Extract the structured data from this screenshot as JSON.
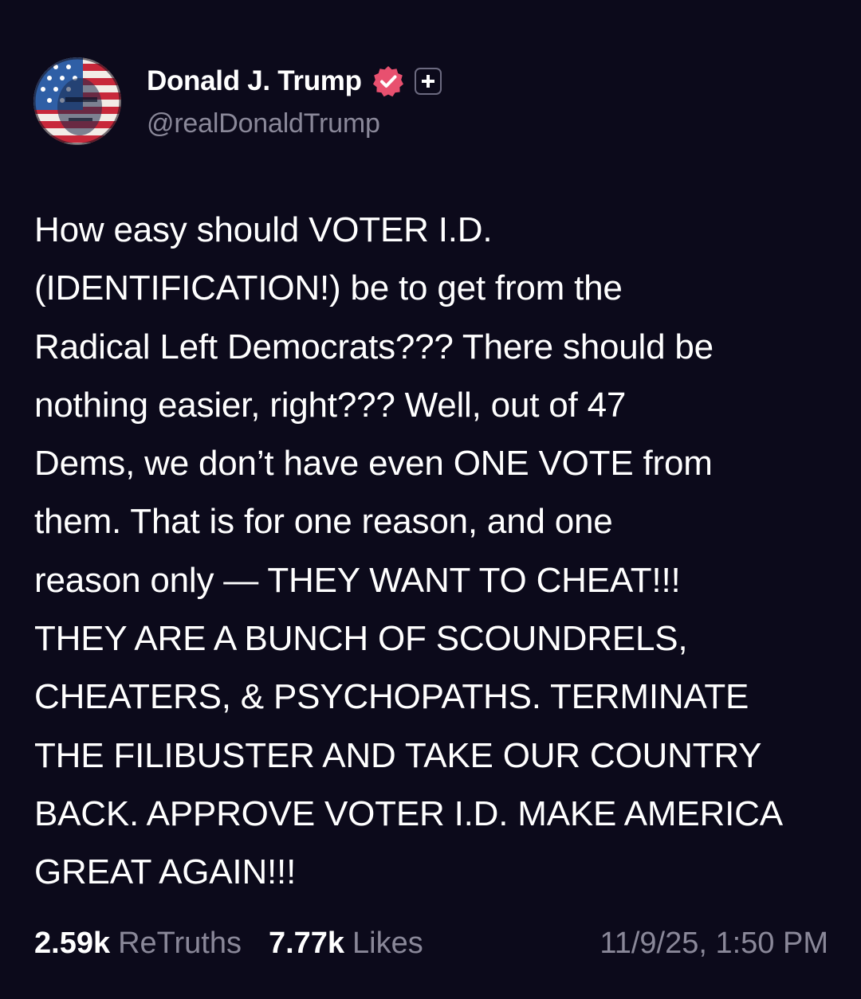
{
  "post": {
    "author": {
      "display_name": "Donald J. Trump",
      "handle": "@realDonaldTrump",
      "avatar_icon": "flag-face-portrait",
      "verified_icon": "verified-badge-icon",
      "verified_color": "#e8506f",
      "plus_icon": "plus-badge-icon"
    },
    "text": "How easy should VOTER I.D.\n(IDENTIFICATION!) be to get from the\nRadical Left Democrats??? There should be\nnothing easier, right??? Well, out of 47\nDems, we don’t have even ONE VOTE from\nthem. That is for one reason, and one\nreason only — THEY WANT TO CHEAT!!!\nTHEY ARE A BUNCH OF SCOUNDRELS,\nCHEATERS, & PSYCHOPATHS. TERMINATE\nTHE FILIBUSTER AND TAKE OUR COUNTRY\nBACK. APPROVE VOTER I.D. MAKE AMERICA\nGREAT AGAIN!!!",
    "stats": {
      "retruths_count": "2.59k",
      "retruths_label": "ReTruths",
      "likes_count": "7.77k",
      "likes_label": "Likes"
    },
    "timestamp": "11/9/25, 1:50 PM"
  },
  "colors": {
    "background": "#0c0a1b",
    "text_primary": "#ffffff",
    "text_secondary": "#8a8899"
  }
}
